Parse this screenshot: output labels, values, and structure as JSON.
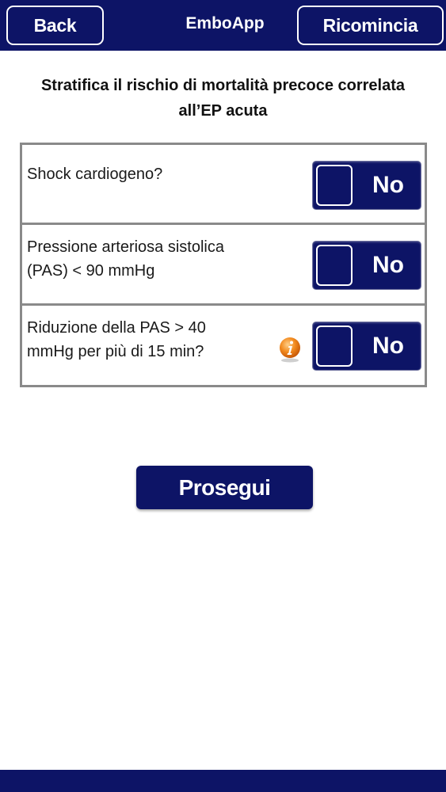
{
  "header": {
    "back_label": "Back",
    "title": "EmboApp",
    "restart_label": "Ricomincia"
  },
  "heading": {
    "line1": "Stratifica il rischio di mortalità precoce correlata",
    "line2": "all’EP acuta"
  },
  "questions": [
    {
      "line1": "Shock cardiogeno?",
      "line2": "",
      "answer": "No",
      "has_info": false
    },
    {
      "line1": "Pressione arteriosa sistolica",
      "line2": "(PAS) < 90 mmHg",
      "answer": "No",
      "has_info": false
    },
    {
      "line1": "Riduzione della PAS > 40",
      "line2": "mmHg per più di 15 min?",
      "answer": "No",
      "has_info": true
    }
  ],
  "proceed_label": "Prosegui",
  "colors": {
    "brand": "#0d1466",
    "border": "#8a8a8a",
    "info": "#f28a1e"
  },
  "icons": {
    "info": "info-icon"
  }
}
